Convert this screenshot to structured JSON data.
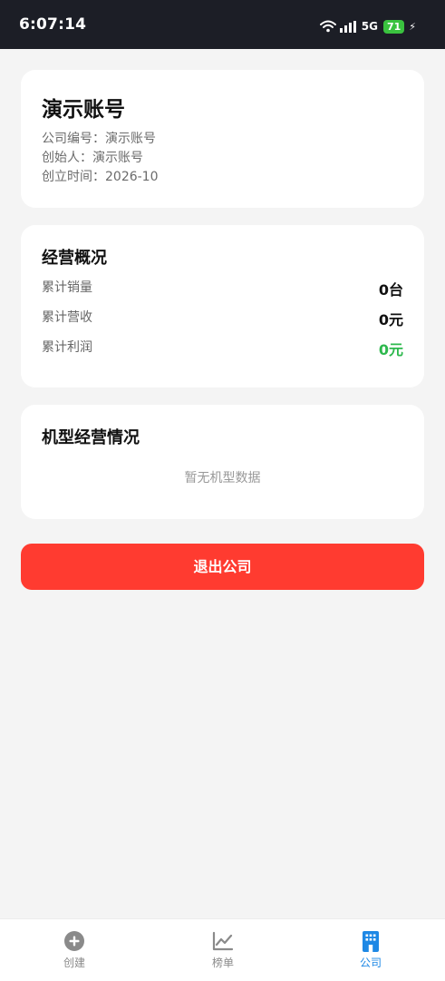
{
  "status_bar": {
    "time": "6:07:14",
    "network": "5G",
    "battery": "71"
  },
  "profile": {
    "company_name": "演示账号",
    "company_code_line": "公司编号：演示账号",
    "founder_line": "创始人：演示账号",
    "founded_line": "创立时间：2026-10"
  },
  "overview": {
    "title": "经营概况",
    "stats": [
      {
        "label": "累计销量",
        "value": "0台"
      },
      {
        "label": "累计营收",
        "value": "0元"
      },
      {
        "label": "累计利润",
        "value": "0元"
      }
    ],
    "profit_color": "#2db84d"
  },
  "models": {
    "title": "机型经营情况",
    "empty_text": "暂无机型数据"
  },
  "actions": {
    "exit_label": "退出公司",
    "exit_color": "#ff3b30"
  },
  "tab_bar": {
    "active_color": "#1e88e5",
    "tabs": [
      {
        "label": "创建",
        "icon": "plus-circle-icon"
      },
      {
        "label": "榜单",
        "icon": "trend-chart-icon"
      },
      {
        "label": "公司",
        "icon": "building-icon"
      }
    ]
  }
}
